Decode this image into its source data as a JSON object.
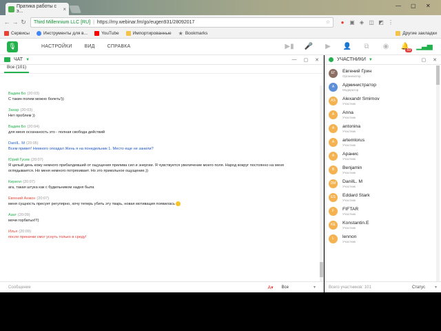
{
  "browser": {
    "tab_title": "Пратика работы с э...",
    "tab_close": "×",
    "address": {
      "secure_label": "Third Millennium LLC [RU]",
      "url": "https://my.webinar.fm/go/eugen931/28092017"
    },
    "bookmarks": [
      {
        "label": "Сервисы",
        "icon": "apps-icon",
        "color": "#e94235"
      },
      {
        "label": "Инструменты для в...",
        "icon": "google-icon",
        "color": "#4285f4"
      },
      {
        "label": "YouTube",
        "icon": "youtube-icon",
        "color": "#ff0000"
      },
      {
        "label": "Импортированные",
        "icon": "folder-icon",
        "color": "#f5c24a"
      },
      {
        "label": "Bookmarks",
        "icon": "star-icon",
        "color": "#777777"
      }
    ],
    "other_bookmarks": "Другие закладки"
  },
  "app": {
    "menu": [
      "НАСТРОЙКИ",
      "ВИД",
      "СПРАВКА"
    ],
    "notification_count": "59",
    "accent": "#22b14c"
  },
  "chat": {
    "title": "ЧАТ",
    "tab_all": "Все (101)",
    "messages": [
      {
        "author": "Вадим Бо",
        "time": "(20:03)",
        "text": "С такин полем можно болеть!))",
        "author_color": "green",
        "text_color": "normal"
      },
      {
        "author": "Захар",
        "time": "(20:03)",
        "text": "Нет проблем ))",
        "author_color": "green",
        "text_color": "normal"
      },
      {
        "author": "Вадим Бо",
        "time": "(20:04)",
        "text": "для меня осознаность это - полная свобода действий",
        "author_color": "green",
        "text_color": "normal"
      },
      {
        "author": "DaniIL. M",
        "time": "(20:05)",
        "text": "Всем привет! Немного опоздал Жень я на понедельник 1. Место еще не занили?",
        "author_color": "blue",
        "text_color": "blue"
      },
      {
        "author": "Юрий Гусев",
        "time": "(20:07)",
        "text": "Я целый день кожу немного прибалдевший от ощущения прилива сил и энергии. Я чувствуется увеличение моего поля. Народ вокруг постоянно на меня",
        "text2": "оглядывается. Но меня немного потряхивает. Но это прикольное ощущение.))",
        "author_color": "green",
        "text_color": "normal"
      },
      {
        "author": "Кирилл",
        "time": "(20:07)",
        "text": "ага, такая штука как с будильником надня была",
        "author_color": "green",
        "text_color": "normal"
      },
      {
        "author": "Евгений Анжон",
        "time": "(20:07)",
        "text": "меня сущность пресует регулярно, хочу теперь убить эту тварь, новая мотивация появилась",
        "author_color": "red",
        "text_color": "normal",
        "emoji": true
      },
      {
        "author": "Азат",
        "time": "(20:09)",
        "text": "мочи горбатых!!!)",
        "author_color": "green",
        "text_color": "normal"
      },
      {
        "author": "Илья",
        "time": "(20:09)",
        "text": "после прекачки смог уснуть только в среду!",
        "author_color": "red",
        "text_color": "red"
      }
    ],
    "composer_placeholder": "Сообщение",
    "scope": "Все"
  },
  "participants": {
    "title": "УЧАСТНИКИ",
    "list": [
      {
        "name": "Евгений Грин",
        "role": "Организатор",
        "avatar_color": "#8d6e63",
        "initials": "ЕГ"
      },
      {
        "name": "Администратор",
        "role": "Модератор",
        "avatar_color": "#5c8fd8",
        "initials": "А"
      },
      {
        "name": "Alexandr Smirnov",
        "role": "Участник",
        "avatar_color": "#f4b350",
        "initials": "AS"
      },
      {
        "name": "Anna",
        "role": "Участник",
        "avatar_color": "#f4b350",
        "initials": "A"
      },
      {
        "name": "antonina",
        "role": "Участник",
        "avatar_color": "#f4b350",
        "initials": "A"
      },
      {
        "name": "artemlorus",
        "role": "Участник",
        "avatar_color": "#f4b350",
        "initials": "A"
      },
      {
        "name": "Аранис",
        "role": "Участник",
        "avatar_color": "#f4b350",
        "initials": "A"
      },
      {
        "name": "Benjamin",
        "role": "Участник",
        "avatar_color": "#f4b350",
        "initials": "B"
      },
      {
        "name": "DaniIL. M",
        "role": "Участник",
        "avatar_color": "#f4b350",
        "initials": "DM"
      },
      {
        "name": "Eddard Stark",
        "role": "Участник",
        "avatar_color": "#f4b350",
        "initials": "ES"
      },
      {
        "name": "FIFTAR",
        "role": "Участник",
        "avatar_color": "#f4b350",
        "initials": "F"
      },
      {
        "name": "Konstantin.E",
        "role": "Участник",
        "avatar_color": "#f4b350",
        "initials": "KE"
      },
      {
        "name": "lennon",
        "role": "Участник",
        "avatar_color": "#f4b350",
        "initials": "L"
      }
    ],
    "footer_total": "Всего участников: 101",
    "footer_status": "Статус"
  }
}
